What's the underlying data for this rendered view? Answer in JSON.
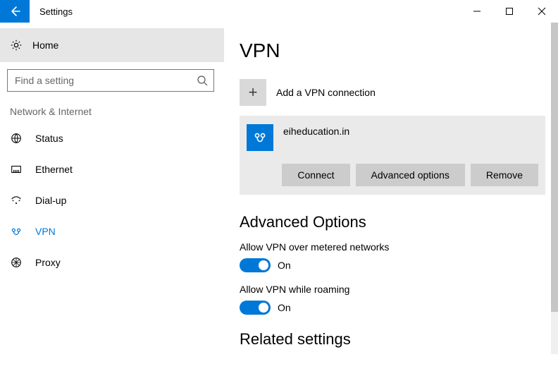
{
  "titlebar": {
    "title": "Settings"
  },
  "sidebar": {
    "home_label": "Home",
    "search_placeholder": "Find a setting",
    "section_label": "Network & Internet",
    "items": [
      {
        "label": "Status"
      },
      {
        "label": "Ethernet"
      },
      {
        "label": "Dial-up"
      },
      {
        "label": "VPN"
      },
      {
        "label": "Proxy"
      }
    ]
  },
  "main": {
    "title": "VPN",
    "add_label": "Add a VPN connection",
    "connection": {
      "name": "eiheducation.in",
      "connect_label": "Connect",
      "advanced_label": "Advanced options",
      "remove_label": "Remove"
    },
    "advanced_heading": "Advanced Options",
    "toggles": [
      {
        "label": "Allow VPN over metered networks",
        "state": "On"
      },
      {
        "label": "Allow VPN while roaming",
        "state": "On"
      }
    ],
    "related_heading": "Related settings"
  }
}
